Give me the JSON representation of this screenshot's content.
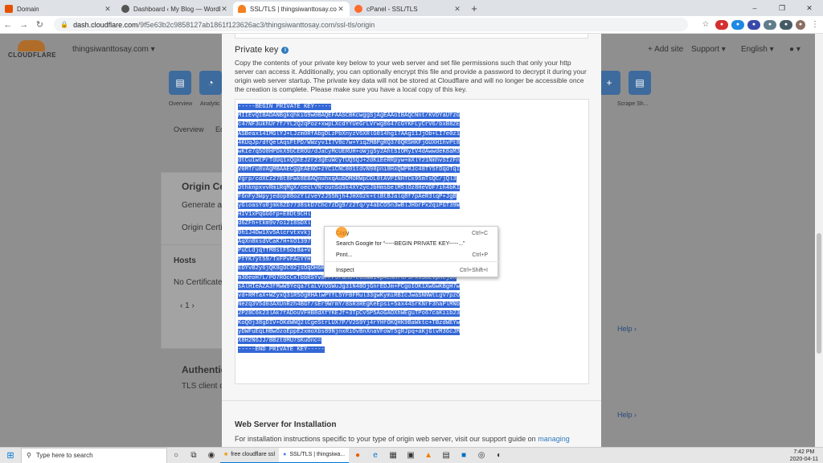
{
  "browser": {
    "tabs": [
      {
        "title": "Domain",
        "color": "#e65100"
      },
      {
        "title": "Dashboard ‹ My Blog — WordPress",
        "color": "#555555"
      },
      {
        "title": "SSL/TLS | thingsiwanttosay.com | Ac",
        "color": "#f38020"
      },
      {
        "title": "cPanel - SSL/TLS",
        "color": "#ff6c2c"
      }
    ],
    "new_tab": "+",
    "window_controls": [
      "–",
      "❐",
      "✕"
    ],
    "url_domain": "dash.cloudflare.com",
    "url_path": "/9f5e63b2c9858127ab1861f123626ac3/thingsiwanttosay.com/ssl-tls/origin"
  },
  "cloudflare": {
    "logo_text": "CLOUDFLARE",
    "site_selector": "thingsiwanttosay.com ▾",
    "add_site": "+ Add site",
    "support": "Support ▾",
    "language": "English ▾",
    "account": "● ▾",
    "nav_labels": [
      "Overview",
      "Analytic",
      "Scrape Sh..."
    ],
    "subnav": [
      "Overview",
      "Ed"
    ],
    "bg_fragments": {
      "origin_ce": "Origin Ce",
      "generate": "Generate a f",
      "origin_certif": "Origin Certif",
      "hosts": "Hosts",
      "no_certificates": "No Certificates",
      "pager": "‹   1   ›",
      "authentic": "Authentic",
      "tls_client": "TLS client ce",
      "help1": "Help ›",
      "help2": "Help ›"
    }
  },
  "modal": {
    "private_key_title": "Private key",
    "private_key_desc": "Copy the contents of your private key below to your web server and set file permissions such that only your http server can access it. Additionally, you can optionally encrypt this file and provide a password to decrypt it during your origin web server startup. The private key data will not be stored at Cloudflare and will no longer be accessible once the creation is complete. Please make sure you have a local copy of this key.",
    "key_lines": [
      "-----BEGIN PRIVATE KEY-----",
      "MIIEvQIBADANBgkqhkiG9w0BAQEFAASCBKcwggSjAgEAAoIBAQCNnt/KVDYaUfzG",
      "c47NF3ukhUr7f/YL2Q2qPoz+xwpLXcdYYUeGrLVrwg8647cGYKFLyCrV6/bxB8ZE",
      "ASBeax14IMGlYJ+LJzm0RfAbgDLzPbXnyzV6XRlG014hg17AAg11JjOb+LI7e0z1",
      "4KUqJp/dfQelAqsFtPD/WWzyv1I7V8c7w+YiqZMBPgRQ370QRSHKFjGUXH1hvPt8",
      "wKIe7q5O8HPDkX9bCEROU/dJaCyMcUERUH+oWjg5y2AhtSIOMyIV4dAwwdeK8aM3",
      "dtCu1wtPrTdUq1xQgkEJzr23gEuWcyTUQ5QJ+2dKiEeRRpyw+mXlY21NmhvSIzFn",
      "V0MTru8vAgMBAAECggEAENO+zYCiCNC801tdvN98pni8HxQWPRJc48TY5fDqdTqI",
      "Vgrp/cdXCz27Bt8Fwk8EBAQnuhxqAubDMORWpCDL0tAVPINHTCk95mTsQC/jQl3",
      "DthknpxvvRmiRqMgX/oecLVNrounSd3k4XY2ycJbHmsbelM5lOz8HeVDF7ih4bKI",
      "F6nFy3Wpyjedop88ozYlzveY2J55Njh4JHXGzk+tlBtBJalq8f7pAeR3lqP+JgB",
      "yGloasYu0jmk8ZD7738skD7Chc7zDg9/z2Tq/y4abCO5n3wBlJHbrPx2qiPGT39W",
      "HIV1xPqGG6fp+E8Dt9CHl",
      "d6ZFh+tkm9v7oi2I8SDXl",
      "0h1J4Dw1Xv5Alcrvtxvkj",
      "AqXn8ksdVCaK7H+kO1397",
      "PuCLdjqTTM8stF5oI8a+V",
      "PfYK7yt59/TxFPvFAcYYH",
      "EDYvB2y6jQK8gOC92jsOqOH6Rmsgf3VwwErd0eW6lBBKIizGAg6+nDIqWBPQrDBe",
      "m30eoH7L/PO7ROcCxTbbRSYv8FPP3faHo+e65WW14p4LNnfu/9FxxSOEVphCjUn",
      "sAlHIeAZA3fMwW9Yeqa7taLVYOSWuJg31N4BOjGnrEDJm+PCgoIOK1XwGwKBgH7w",
      "vd+RMTaX+WZyxQ31R5OgRHAlwPYfL5YFBFMul33gwKymiRBIcJwaSNNWtLgV7pzO",
      "Nezq3V5d03AXUnRzh4BGf/sEr9WrmY/8SR3REgKeEpsi+5ax44SrKNrF3haPlMNb",
      "2P28C6k23lAk7fADouVFHB8dXfYKEJf+3TpCv5P5AoGAOXhWEguTPo67caKiib23",
      "KoQOj38gDIV+OKdWNQ2lCgeStrLUX7P/V2S9Yj4rYHfOKQHK9BaWktc+TBzdWEYw",
      "yDWFuEqLHBwOzoEppE2xmoXbs89NjnxRiOvBnXnaVFoWT5gRJpq+aKjGlvM36cJM",
      "X8H2N6JJ/BBzt0MU7SKuOnc=",
      "-----END PRIVATE KEY-----"
    ],
    "web_server_title": "Web Server for Installation",
    "web_server_desc": "For installation instructions specific to your type of origin web server, visit our support guide on",
    "web_server_link": "managing"
  },
  "context_menu": {
    "items": [
      {
        "label": "Copy",
        "shortcut": "Ctrl+C"
      },
      {
        "label": "Search Google for “-----BEGIN PRIVATE KEY-----...”",
        "shortcut": ""
      },
      {
        "label": "Print...",
        "shortcut": "Ctrl+P"
      },
      {
        "label": "Inspect",
        "shortcut": "Ctrl+Shift+I"
      }
    ]
  },
  "taskbar": {
    "search_placeholder": "Type here to search",
    "apps": [
      {
        "label": "free cloudflare ssl"
      },
      {
        "label": "SSL/TLS | thingsiwa..."
      }
    ],
    "time": "7:42 PM",
    "date": "2020-04-11"
  }
}
